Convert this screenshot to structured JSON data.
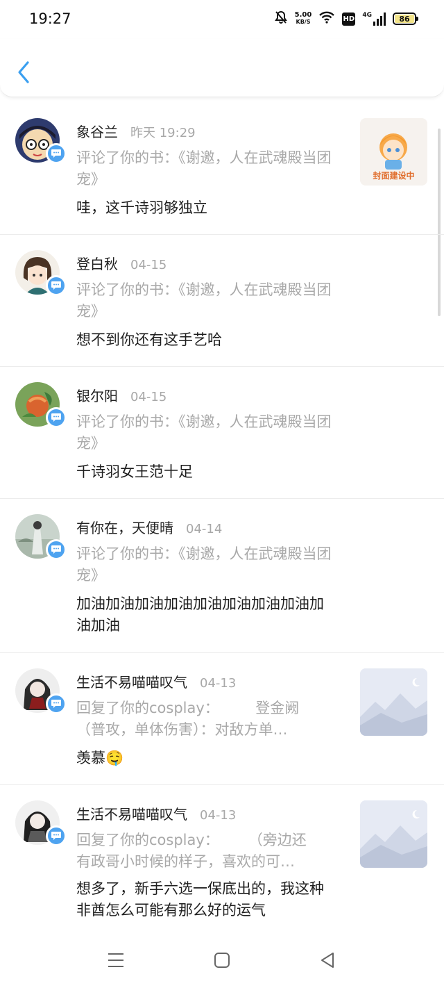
{
  "status_bar": {
    "time": "19:27",
    "net_speed_value": "5.00",
    "net_speed_unit": "KB/S",
    "hd_label": "HD",
    "network_label": "4G",
    "battery_level": "86"
  },
  "header": {
    "back_icon": "chevron-left-icon",
    "accent_color": "#3a9ff0"
  },
  "messages": [
    {
      "name": "象谷兰",
      "time": "昨天 19:29",
      "ref": "评论了你的书：《谢邀，人在武魂殿当团宠》",
      "text": "哇，这千诗羽够独立",
      "thumb_caption": "封面建设中"
    },
    {
      "name": "登白秋",
      "time": "04-15",
      "ref": "评论了你的书：《谢邀，人在武魂殿当团宠》",
      "text": "想不到你还有这手艺哈"
    },
    {
      "name": "银尔阳",
      "time": "04-15",
      "ref": "评论了你的书：《谢邀，人在武魂殿当团宠》",
      "text": "千诗羽女王范十足"
    },
    {
      "name": "有你在，天便晴",
      "time": "04-14",
      "ref": "评论了你的书：《谢邀，人在武魂殿当团宠》",
      "text": "加油加油加油加油加油加油加油加油加油加油"
    },
    {
      "name": "生活不易喵喵叹气",
      "time": "04-13",
      "ref_line1": "回复了你的cosplay：　　　登金阙",
      "ref_line2": "（普攻，单体伤害）：对敌方单…",
      "text": "羡慕🤤"
    },
    {
      "name": "生活不易喵喵叹气",
      "time": "04-13",
      "ref_line1": "回复了你的cosplay：　　　（旁边还",
      "ref_line2": "有政哥小时候的样子，喜欢的可…",
      "text": "想多了，新手六选一保底出的，我这种非酋怎么可能有那么好的运气"
    }
  ],
  "nav": {
    "menu_icon": "menu-icon",
    "home_icon": "home-icon",
    "back_icon": "back-triangle-icon"
  }
}
